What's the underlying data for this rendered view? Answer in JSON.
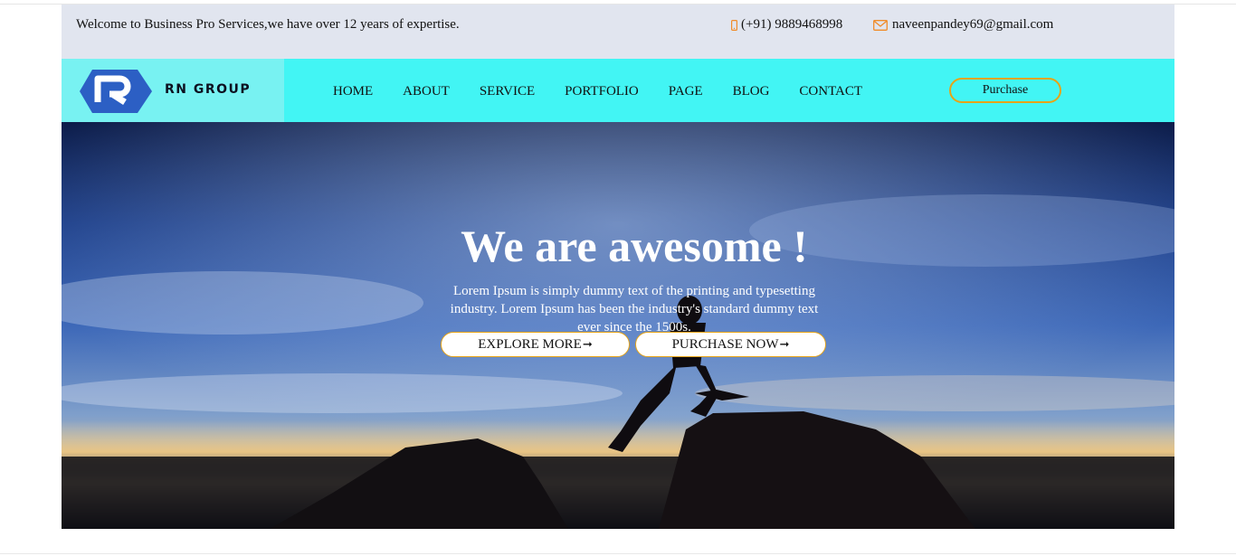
{
  "topbar": {
    "welcome": "Welcome to Business Pro Services,we have over 12 years of expertise.",
    "phone": "(+91) 9889468998",
    "email": "naveenpandey69@gmail.com",
    "phone_icon": "mobile-phone-icon",
    "email_icon": "envelope-icon"
  },
  "brand": {
    "logo_letter": "R",
    "name": "RN GROUP"
  },
  "nav": {
    "items": [
      {
        "label": "HOME"
      },
      {
        "label": "ABOUT"
      },
      {
        "label": "SERVICE"
      },
      {
        "label": "PORTFOLIO"
      },
      {
        "label": "PAGE"
      },
      {
        "label": "BLOG"
      },
      {
        "label": "CONTACT"
      }
    ],
    "purchase": "Purchase"
  },
  "hero": {
    "title": "We are awesome !",
    "text": "Lorem Ipsum is simply dummy text of the printing and typesetting industry. Lorem Ipsum has been the industry's standard dummy text ever since the 1500s.",
    "explore_label": "EXPLORE MORE",
    "purchase_label": "PURCHASE NOW",
    "arrow": "➞"
  },
  "colors": {
    "topbar_bg": "#e1e5ef",
    "nav_bg": "#42f5f4",
    "logo_bg": "#78f2f2",
    "accent": "#e6a418",
    "logo_blue": "#2c5fc4"
  }
}
